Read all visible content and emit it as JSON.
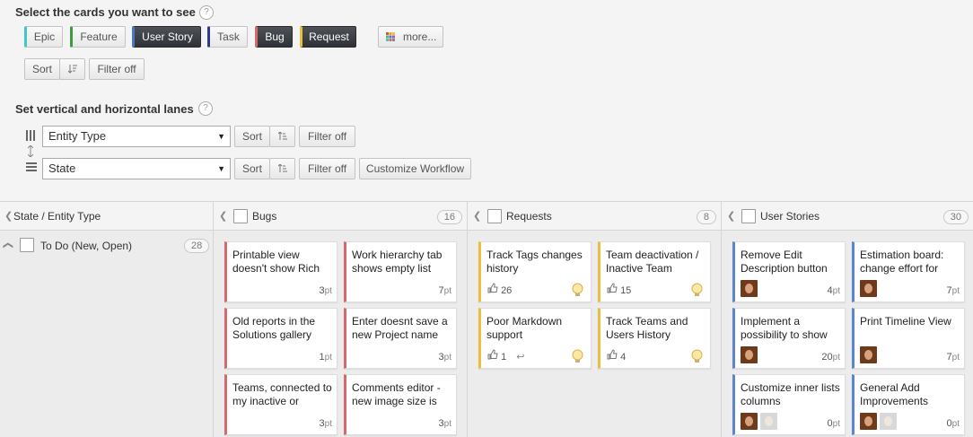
{
  "cards_section": {
    "heading": "Select the cards you want to see",
    "help": "?",
    "chips": [
      {
        "label": "Epic",
        "color": "#3ec9c1",
        "active": false
      },
      {
        "label": "Feature",
        "color": "#3f9b3f",
        "active": false
      },
      {
        "label": "User Story",
        "color": "#4a78c9",
        "active": true
      },
      {
        "label": "Task",
        "color": "#2d3a8a",
        "active": false
      },
      {
        "label": "Bug",
        "color": "#d46a6a",
        "active": true
      },
      {
        "label": "Request",
        "color": "#e8c040",
        "active": true
      }
    ],
    "more_label": "more...",
    "sort_label": "Sort",
    "filter_label": "Filter off"
  },
  "lanes_section": {
    "heading": "Set vertical and horizontal lanes",
    "help": "?",
    "vertical": {
      "value": "Entity Type",
      "sort_label": "Sort",
      "filter_label": "Filter off"
    },
    "horizontal": {
      "value": "State",
      "sort_label": "Sort",
      "filter_label": "Filter off",
      "workflow_label": "Customize Workflow"
    }
  },
  "board": {
    "axis_label": "State / Entity Type",
    "row": {
      "label": "To Do (New, Open)",
      "count": "28"
    },
    "columns": [
      {
        "title": "Bugs",
        "count": "16",
        "accent": "#d46a6a",
        "cards": [
          {
            "title": "Printable view doesn't show Rich",
            "points": "3",
            "unit": "pt"
          },
          {
            "title": "Work hierarchy tab shows empty list",
            "points": "7",
            "unit": "pt"
          },
          {
            "title": "Old reports in the Solutions gallery",
            "points": "1",
            "unit": "pt"
          },
          {
            "title": "Enter doesnt save a new Project name",
            "points": "3",
            "unit": "pt"
          },
          {
            "title": "Teams, connected to my inactive or",
            "points": "3",
            "unit": "pt"
          },
          {
            "title": "Comments editor - new image size is",
            "points": "3",
            "unit": "pt"
          }
        ]
      },
      {
        "title": "Requests",
        "count": "8",
        "accent": "#e8c040",
        "cards": [
          {
            "title": "Track Tags changes history",
            "likes": "26"
          },
          {
            "title": "Team deactivation / Inactive Team",
            "likes": "15"
          },
          {
            "title": "Poor Markdown support",
            "likes": "1",
            "reply": "↩"
          },
          {
            "title": "Track Teams and Users History",
            "likes": "4"
          }
        ]
      },
      {
        "title": "User Stories",
        "count": "30",
        "accent": "#5b87c9",
        "cards": [
          {
            "title": "Remove Edit Description button",
            "points": "4",
            "unit": "pt"
          },
          {
            "title": "Estimation board: change effort for",
            "points": "7",
            "unit": "pt"
          },
          {
            "title": "Implement a possibility to show",
            "points": "20",
            "unit": "pt"
          },
          {
            "title": "Print Timeline View",
            "points": "7",
            "unit": "pt"
          },
          {
            "title": "Customize inner lists columns",
            "points": "0",
            "unit": "pt"
          },
          {
            "title": "General Add Improvements",
            "points": "0",
            "unit": "pt"
          }
        ]
      }
    ]
  }
}
